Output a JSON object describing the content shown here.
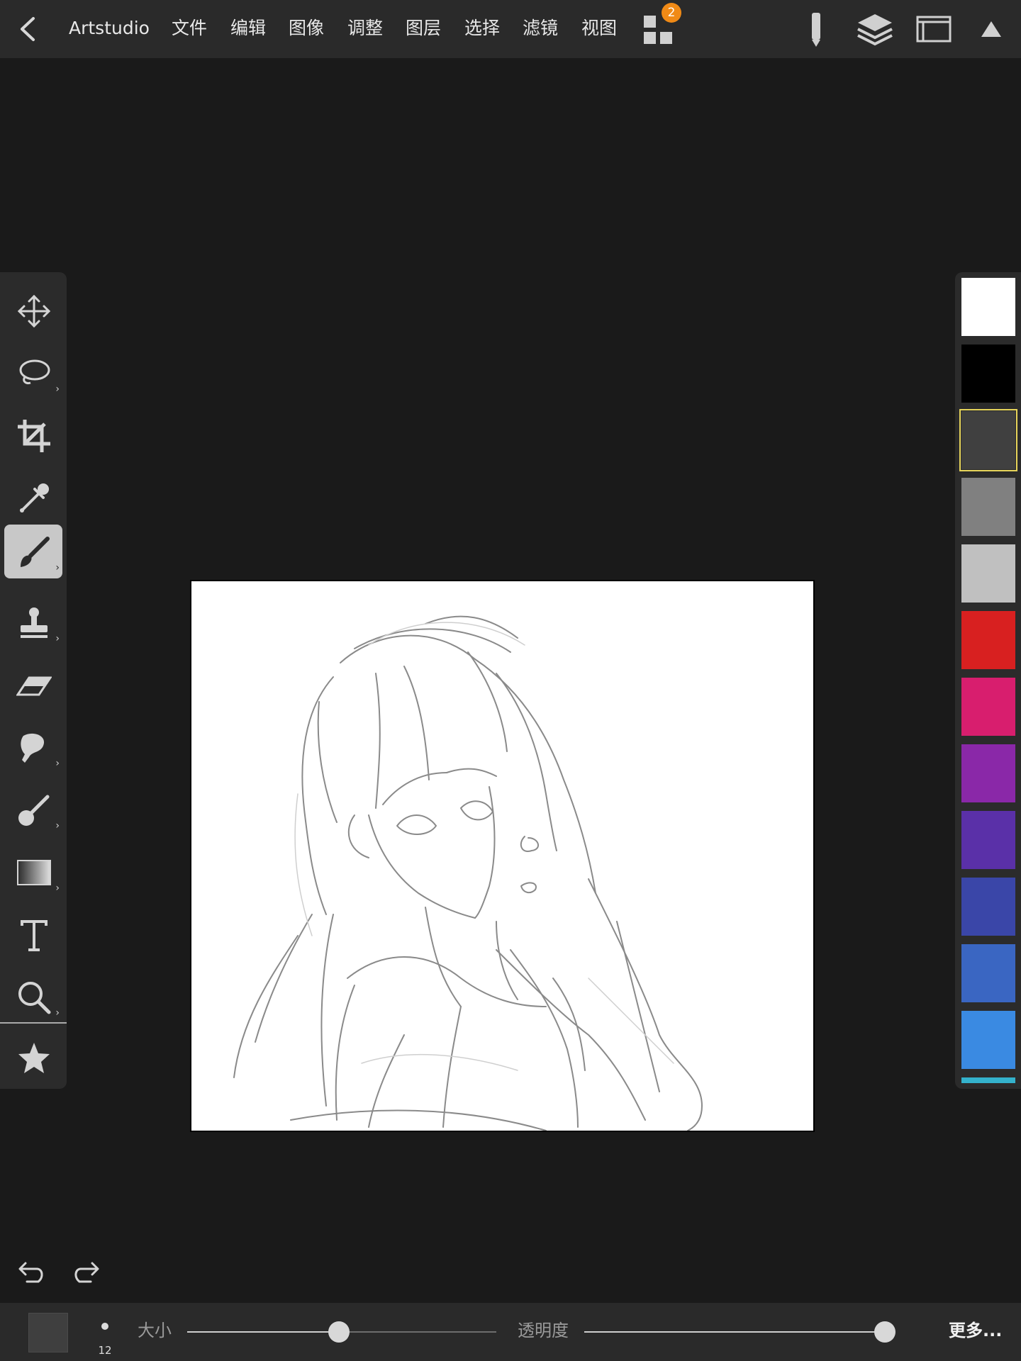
{
  "app": {
    "title": "Artstudio"
  },
  "menu": {
    "items": [
      {
        "label": "文件"
      },
      {
        "label": "编辑"
      },
      {
        "label": "图像"
      },
      {
        "label": "调整"
      },
      {
        "label": "图层"
      },
      {
        "label": "选择"
      },
      {
        "label": "滤镜"
      },
      {
        "label": "视图"
      }
    ]
  },
  "apps_badge": "2",
  "right_icons": [
    "pencil-icon",
    "layers-icon",
    "window-icon",
    "collapse-arrow-icon"
  ],
  "tools": [
    {
      "name": "move",
      "icon": "move-icon",
      "expandable": false
    },
    {
      "name": "lasso",
      "icon": "lasso-icon",
      "expandable": true
    },
    {
      "name": "crop",
      "icon": "crop-icon",
      "expandable": false
    },
    {
      "name": "eyedropper",
      "icon": "eyedropper-icon",
      "expandable": false
    },
    {
      "name": "brush",
      "icon": "brush-icon",
      "expandable": true,
      "active": true
    },
    {
      "name": "stamp",
      "icon": "stamp-icon",
      "expandable": true
    },
    {
      "name": "eraser",
      "icon": "eraser-icon",
      "expandable": false
    },
    {
      "name": "smudge",
      "icon": "smudge-icon",
      "expandable": true
    },
    {
      "name": "dodge",
      "icon": "dodge-icon",
      "expandable": true
    },
    {
      "name": "gradient",
      "icon": "gradient-icon",
      "expandable": true
    },
    {
      "name": "text",
      "icon": "text-icon",
      "expandable": false
    },
    {
      "name": "zoom",
      "icon": "zoom-icon",
      "expandable": true
    },
    {
      "name": "favorites",
      "icon": "star-icon",
      "expandable": false
    }
  ],
  "tool_more_glyph": "›",
  "palette": {
    "colors": [
      "#ffffff",
      "#000000",
      "#404040",
      "#808080",
      "#c0c0c0",
      "#d82020",
      "#d81e6e",
      "#8a28a8",
      "#5a30a8",
      "#3a46a8",
      "#3a66c2",
      "#3a8ae2",
      "#34b2cc"
    ],
    "selected_index": 2,
    "selected_outline": "#e6d45a"
  },
  "bottom": {
    "current_color": "#3f3f3f",
    "brush_size": "12",
    "size_label": "大小",
    "size_value": 0.49,
    "opacity_label": "透明度",
    "opacity_value": 1.0,
    "more_label": "更多..."
  },
  "accent": "#f08a16"
}
